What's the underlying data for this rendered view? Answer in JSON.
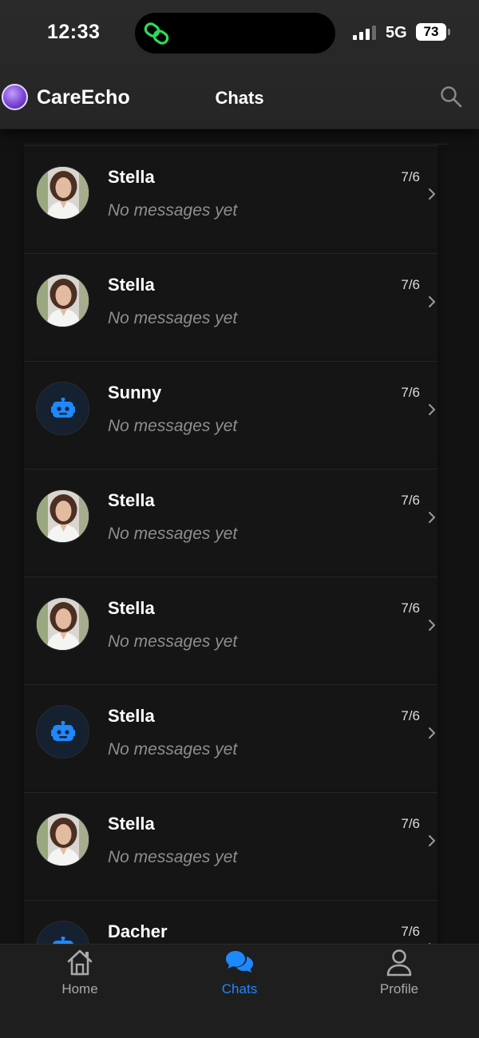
{
  "status_bar": {
    "time": "12:33",
    "network": "5G",
    "battery": "73"
  },
  "header": {
    "brand": "CareEcho",
    "title": "Chats",
    "search_icon": "search-icon"
  },
  "chats": [
    {
      "name": "Stella",
      "preview": "No messages yet",
      "date": "7/6",
      "avatar": "photo"
    },
    {
      "name": "Stella",
      "preview": "No messages yet",
      "date": "7/6",
      "avatar": "photo"
    },
    {
      "name": "Sunny",
      "preview": "No messages yet",
      "date": "7/6",
      "avatar": "bot"
    },
    {
      "name": "Stella",
      "preview": "No messages yet",
      "date": "7/6",
      "avatar": "photo"
    },
    {
      "name": "Stella",
      "preview": "No messages yet",
      "date": "7/6",
      "avatar": "photo"
    },
    {
      "name": "Stella",
      "preview": "No messages yet",
      "date": "7/6",
      "avatar": "bot"
    },
    {
      "name": "Stella",
      "preview": "No messages yet",
      "date": "7/6",
      "avatar": "photo"
    },
    {
      "name": "Dacher",
      "preview": "",
      "date": "7/6",
      "avatar": "bot"
    }
  ],
  "tabs": [
    {
      "label": "Home",
      "icon": "home-icon",
      "active": false
    },
    {
      "label": "Chats",
      "icon": "chat-bubbles-icon",
      "active": true
    },
    {
      "label": "Profile",
      "icon": "user-icon",
      "active": false
    }
  ],
  "colors": {
    "accent": "#1e88ff",
    "background": "#121212",
    "header": "#262626",
    "bot_icon": "#1e88ff",
    "island_icon": "#2ddc5a"
  }
}
